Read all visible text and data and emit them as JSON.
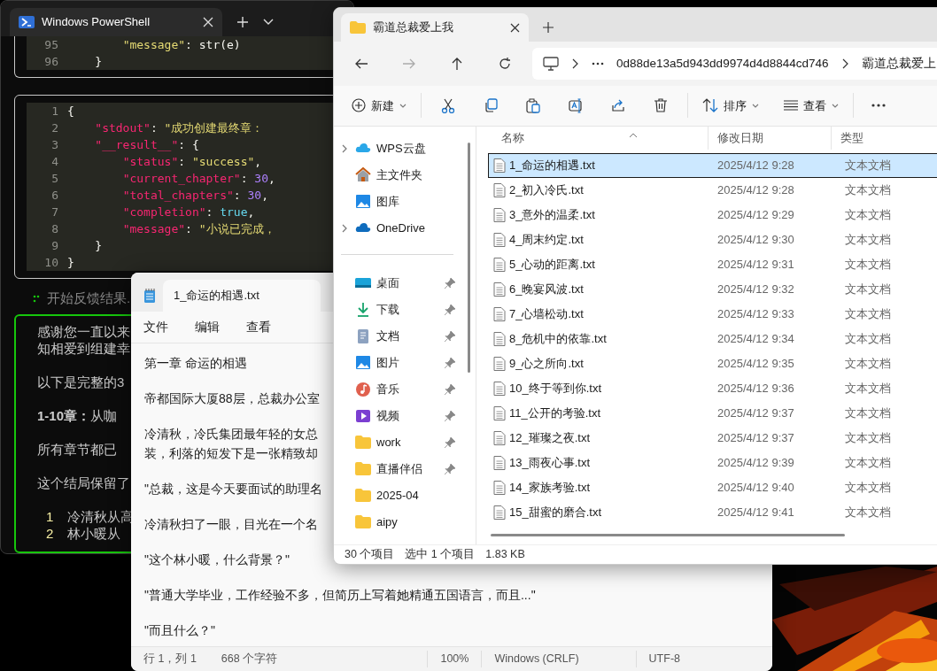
{
  "terminal": {
    "tab_title": "Windows PowerShell",
    "code_blocks": [
      {
        "lines": [
          {
            "number": "95",
            "tokens": [
              {
                "kind": "string",
                "text": "        \"message\""
              },
              {
                "kind": "plain",
                "text": ": str(e)"
              }
            ]
          },
          {
            "number": "96",
            "tokens": [
              {
                "kind": "plain",
                "text": "    }"
              }
            ]
          }
        ]
      },
      {
        "lines": [
          {
            "number": "1",
            "tokens": [
              {
                "kind": "plain",
                "text": "{"
              }
            ]
          },
          {
            "number": "2",
            "tokens": [
              {
                "kind": "key",
                "text": "    \"stdout\""
              },
              {
                "kind": "plain",
                "text": ": "
              },
              {
                "kind": "string",
                "text": "\"成功创建最终章："
              }
            ]
          },
          {
            "number": "3",
            "tokens": [
              {
                "kind": "key",
                "text": "    \"__result__\""
              },
              {
                "kind": "plain",
                "text": ": {"
              }
            ]
          },
          {
            "number": "4",
            "tokens": [
              {
                "kind": "key",
                "text": "        \"status\""
              },
              {
                "kind": "plain",
                "text": ": "
              },
              {
                "kind": "string",
                "text": "\"success\""
              },
              {
                "kind": "plain",
                "text": ","
              }
            ]
          },
          {
            "number": "5",
            "tokens": [
              {
                "kind": "key",
                "text": "        \"current_chapter\""
              },
              {
                "kind": "plain",
                "text": ": "
              },
              {
                "kind": "number",
                "text": "30"
              },
              {
                "kind": "plain",
                "text": ","
              }
            ]
          },
          {
            "number": "6",
            "tokens": [
              {
                "kind": "key",
                "text": "        \"total_chapters\""
              },
              {
                "kind": "plain",
                "text": ": "
              },
              {
                "kind": "number",
                "text": "30"
              },
              {
                "kind": "plain",
                "text": ","
              }
            ]
          },
          {
            "number": "7",
            "tokens": [
              {
                "kind": "key",
                "text": "        \"completion\""
              },
              {
                "kind": "plain",
                "text": ": "
              },
              {
                "kind": "bool",
                "text": "true"
              },
              {
                "kind": "plain",
                "text": ","
              }
            ]
          },
          {
            "number": "8",
            "tokens": [
              {
                "kind": "key",
                "text": "        \"message\""
              },
              {
                "kind": "plain",
                "text": ": "
              },
              {
                "kind": "string",
                "text": "\"小说已完成，"
              }
            ]
          },
          {
            "number": "9",
            "tokens": [
              {
                "kind": "plain",
                "text": "    }"
              }
            ]
          },
          {
            "number": "10",
            "tokens": [
              {
                "kind": "plain",
                "text": "}"
              }
            ]
          }
        ]
      }
    ],
    "status_line": "开始反馈结果.",
    "response": [
      {
        "kind": "text",
        "lines": [
          "感谢您一直以来",
          "知相爱到组建幸"
        ]
      },
      {
        "kind": "text",
        "lines": [
          "以下是完整的3"
        ]
      },
      {
        "kind": "text",
        "lines": [
          "**1-10章：**从咖"
        ]
      },
      {
        "kind": "text",
        "lines": [
          "所有章节都已"
        ]
      },
      {
        "kind": "text",
        "lines": [
          "这个结局保留了"
        ]
      },
      {
        "kind": "list",
        "items": [
          {
            "number": "1",
            "text": "冷清秋从高"
          },
          {
            "number": "2",
            "text": "林小暖从"
          }
        ]
      }
    ]
  },
  "notepad": {
    "tab_title": "1_命运的相遇.txt",
    "menus": [
      "文件",
      "编辑",
      "查看"
    ],
    "paragraphs": [
      [
        "第一章 命运的相遇"
      ],
      [
        "帝都国际大厦88层，总裁办公室"
      ],
      [
        "冷清秋，冷氏集团最年轻的女总",
        "装，利落的短发下是一张精致却"
      ],
      [
        "\"总裁，这是今天要面试的助理名"
      ],
      [
        "冷清秋扫了一眼，目光在一个名"
      ],
      [
        "\"这个林小暖，什么背景？\""
      ],
      [
        "\"普通大学毕业，工作经验不多，但简历上写着她精通五国语言，而且...\""
      ],
      [
        "\"而且什么？\""
      ]
    ],
    "status": [
      "行 1，列 1",
      "668 个字符",
      "100%",
      "Windows (CRLF)",
      "UTF-8"
    ]
  },
  "explorer": {
    "tab_title": "霸道总裁爱上我",
    "address": [
      "0d88de13a5d943dd9974d4d8844cd746",
      "霸道总裁爱上"
    ],
    "commands": {
      "new": "新建",
      "sort": "排序",
      "view": "查看"
    },
    "sidebar": {
      "locations": [
        {
          "label": "WPS云盘",
          "kind": "wps",
          "expandable": true
        },
        {
          "label": "主文件夹",
          "kind": "home",
          "expandable": false
        },
        {
          "label": "图库",
          "kind": "gallery",
          "expandable": false
        },
        {
          "label": "OneDrive",
          "kind": "onedrive",
          "expandable": true
        }
      ],
      "quick_access": [
        {
          "label": "桌面",
          "kind": "desktop",
          "pinned": true
        },
        {
          "label": "下载",
          "kind": "download",
          "pinned": true
        },
        {
          "label": "文档",
          "kind": "document",
          "pinned": true
        },
        {
          "label": "图片",
          "kind": "pictures",
          "pinned": true
        },
        {
          "label": "音乐",
          "kind": "music",
          "pinned": true
        },
        {
          "label": "视频",
          "kind": "video",
          "pinned": true
        },
        {
          "label": "work",
          "kind": "folder",
          "pinned": true
        },
        {
          "label": "直播伴侣",
          "kind": "folder",
          "pinned": true
        },
        {
          "label": "2025-04",
          "kind": "folder",
          "pinned": false
        },
        {
          "label": "aipy",
          "kind": "folder",
          "pinned": false
        }
      ]
    },
    "columns": [
      "名称",
      "修改日期",
      "类型"
    ],
    "files": [
      {
        "name": "1_命运的相遇.txt",
        "date": "2025/4/12 9:28",
        "type": "文本文档",
        "selected": true
      },
      {
        "name": "2_初入冷氏.txt",
        "date": "2025/4/12 9:28",
        "type": "文本文档",
        "selected": false
      },
      {
        "name": "3_意外的温柔.txt",
        "date": "2025/4/12 9:29",
        "type": "文本文档",
        "selected": false
      },
      {
        "name": "4_周末约定.txt",
        "date": "2025/4/12 9:30",
        "type": "文本文档",
        "selected": false
      },
      {
        "name": "5_心动的距离.txt",
        "date": "2025/4/12 9:31",
        "type": "文本文档",
        "selected": false
      },
      {
        "name": "6_晚宴风波.txt",
        "date": "2025/4/12 9:32",
        "type": "文本文档",
        "selected": false
      },
      {
        "name": "7_心墙松动.txt",
        "date": "2025/4/12 9:33",
        "type": "文本文档",
        "selected": false
      },
      {
        "name": "8_危机中的依靠.txt",
        "date": "2025/4/12 9:34",
        "type": "文本文档",
        "selected": false
      },
      {
        "name": "9_心之所向.txt",
        "date": "2025/4/12 9:35",
        "type": "文本文档",
        "selected": false
      },
      {
        "name": "10_终于等到你.txt",
        "date": "2025/4/12 9:36",
        "type": "文本文档",
        "selected": false
      },
      {
        "name": "11_公开的考验.txt",
        "date": "2025/4/12 9:37",
        "type": "文本文档",
        "selected": false
      },
      {
        "name": "12_璀璨之夜.txt",
        "date": "2025/4/12 9:37",
        "type": "文本文档",
        "selected": false
      },
      {
        "name": "13_雨夜心事.txt",
        "date": "2025/4/12 9:39",
        "type": "文本文档",
        "selected": false
      },
      {
        "name": "14_家族考验.txt",
        "date": "2025/4/12 9:40",
        "type": "文本文档",
        "selected": false
      },
      {
        "name": "15_甜蜜的磨合.txt",
        "date": "2025/4/12 9:41",
        "type": "文本文档",
        "selected": false
      }
    ],
    "status": {
      "count": "30 个项目",
      "selection": "选中 1 个项目",
      "size": "1.83 KB"
    }
  }
}
